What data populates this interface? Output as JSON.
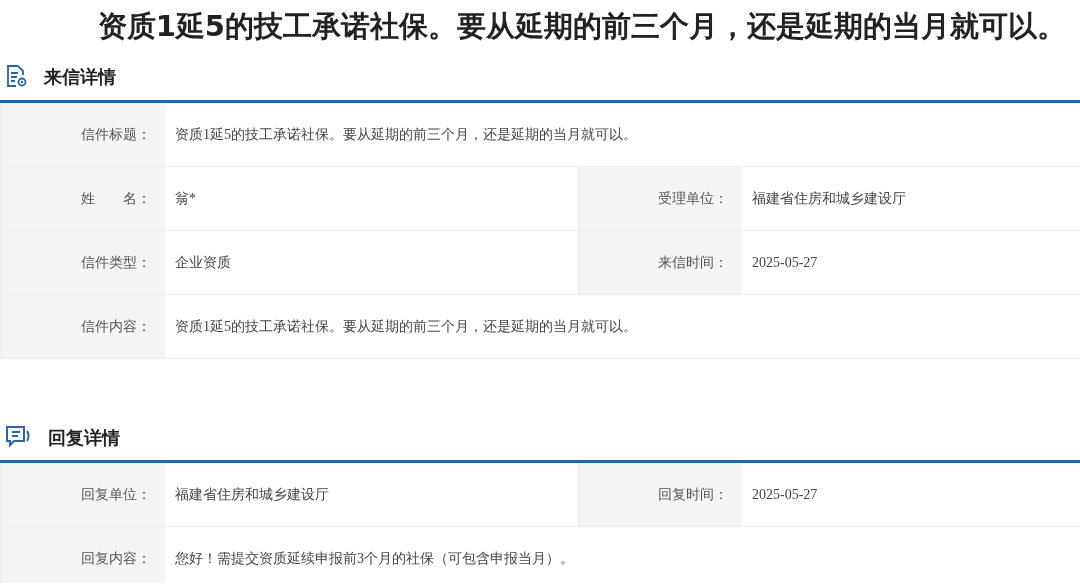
{
  "headline": "资质1延5的技工承诺社保。要从延期的前三个月，还是延期的当月就可以。",
  "sections": [
    {
      "title": "来信详情",
      "kind": "letter",
      "rows": [
        [
          {
            "label": "信件标题：",
            "value": "资质1延5的技工承诺社保。要从延期的前三个月，还是延期的当月就可以。"
          }
        ],
        [
          {
            "label": "姓　　名：",
            "value": "翁*"
          },
          {
            "label": "受理单位：",
            "value": "福建省住房和城乡建设厅"
          }
        ],
        [
          {
            "label": "信件类型：",
            "value": "企业资质"
          },
          {
            "label": "来信时间：",
            "value": "2025-05-27"
          }
        ],
        [
          {
            "label": "信件内容：",
            "value": "资质1延5的技工承诺社保。要从延期的前三个月，还是延期的当月就可以。"
          }
        ]
      ]
    },
    {
      "title": "回复详情",
      "kind": "reply",
      "rows": [
        [
          {
            "label": "回复单位：",
            "value": "福建省住房和城乡建设厅"
          },
          {
            "label": "回复时间：",
            "value": "2025-05-27"
          }
        ],
        [
          {
            "label": "回复内容：",
            "value": "您好！需提交资质延续申报前3个月的社保（可包含申报当月）。"
          }
        ]
      ]
    }
  ]
}
